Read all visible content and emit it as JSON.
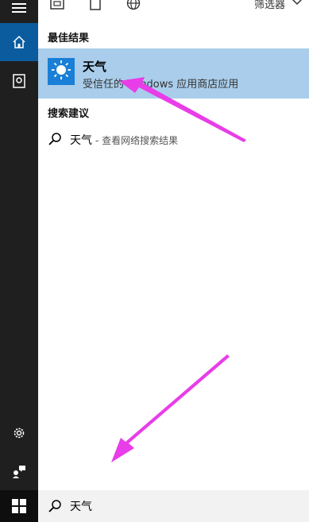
{
  "topbar": {
    "filter_label": "筛选器"
  },
  "sections": {
    "best_match": "最佳结果",
    "suggestions": "搜索建议"
  },
  "best_result": {
    "name": "天气",
    "subtitle": "受信任的 Windows 应用商店应用"
  },
  "suggestion": {
    "query": "天气",
    "hint": "- 查看网络搜索结果"
  },
  "search": {
    "value": "天气"
  },
  "colors": {
    "rail_bg": "#1f1f1f",
    "rail_selected": "#0b5c9e",
    "selected_row": "#a9cdeb",
    "app_icon_bg": "#1a7fd6",
    "annotation_arrow": "#e83de8"
  },
  "icons": {
    "menu": "hamburger-menu-icon",
    "home": "home-icon",
    "documents": "document-icon",
    "settings": "gear-icon",
    "feedback": "feedback-icon",
    "start": "windows-logo-icon",
    "search": "search-icon",
    "weather": "weather-sun-icon"
  }
}
